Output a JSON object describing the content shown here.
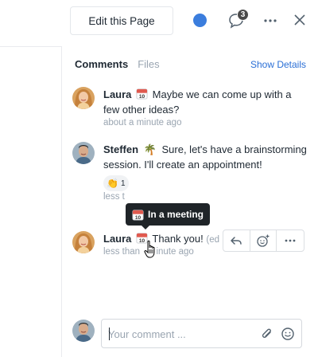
{
  "header": {
    "edit_button_label": "Edit this Page",
    "notification_count": "3",
    "status_color": "#3b7ddd"
  },
  "tabs": [
    {
      "label": "Comments",
      "active": true
    },
    {
      "label": "Files",
      "active": false
    }
  ],
  "show_details_label": "Show Details",
  "comments": [
    {
      "author": "Laura",
      "status_icon": "calendar-icon",
      "status_day": "10",
      "text": "Maybe we can come up with a few other ideas?",
      "time": "about a minute ago"
    },
    {
      "author": "Steffen",
      "status_icon": "palm-tree-icon",
      "text": "Sure, let's have a brainstorming session. I'll create an appointment!",
      "time": "less t",
      "reaction": {
        "emoji": "👏",
        "count": "1"
      }
    },
    {
      "author": "Laura",
      "status_icon": "calendar-icon",
      "status_day": "10",
      "text": "Thank you!",
      "edited_label": "(ed",
      "time_start": "less than",
      "time_end": "inute ago"
    }
  ],
  "tooltip": {
    "icon": "calendar-icon",
    "day": "10",
    "label": "In a meeting"
  },
  "composer": {
    "placeholder": "Your comment ..."
  },
  "colors": {
    "accent": "#2a6fd6",
    "muted": "#9aa5b1",
    "tooltip_bg": "#1f2428"
  }
}
